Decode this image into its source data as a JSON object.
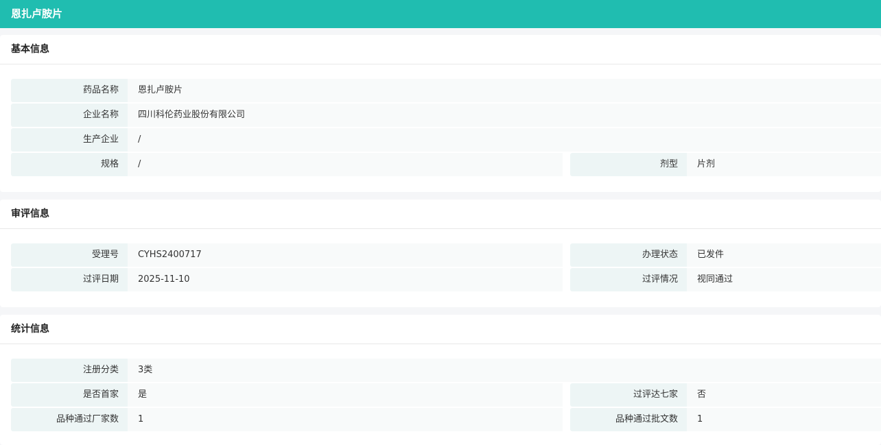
{
  "header": {
    "title": "恩扎卢胺片"
  },
  "basic": {
    "title": "基本信息",
    "drug_name_label": "药品名称",
    "drug_name": "恩扎卢胺片",
    "company_label": "企业名称",
    "company": "四川科伦药业股份有限公司",
    "manufacturer_label": "生产企业",
    "manufacturer": "/",
    "spec_label": "规格",
    "spec": "/",
    "form_label": "剂型",
    "form": "片剂"
  },
  "review": {
    "title": "审评信息",
    "accept_no_label": "受理号",
    "accept_no": "CYHS2400717",
    "status_label": "办理状态",
    "status": "已发件",
    "date_label": "过评日期",
    "date": "2025-11-10",
    "result_label": "过评情况",
    "result": "视同通过"
  },
  "stats": {
    "title": "统计信息",
    "reg_class_label": "注册分类",
    "reg_class": "3类",
    "first_label": "是否首家",
    "first": "是",
    "seven_label": "过评达七家",
    "seven": "否",
    "makers_label": "品种通过厂家数",
    "makers": "1",
    "approvals_label": "品种通过批文数",
    "approvals": "1"
  }
}
